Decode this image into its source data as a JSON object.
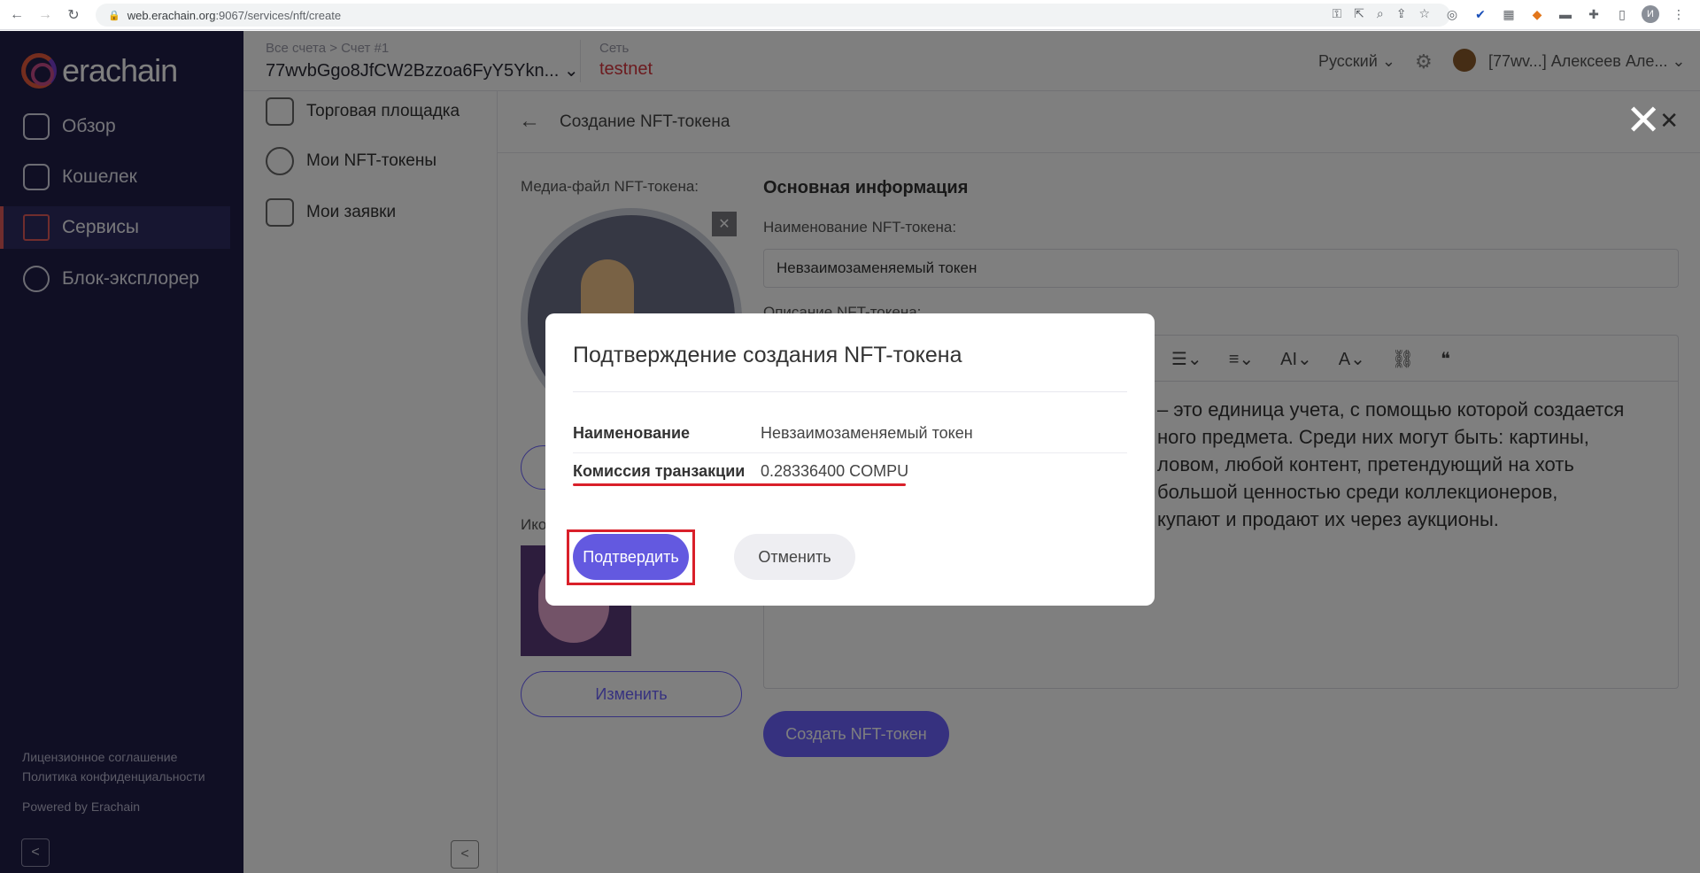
{
  "browser": {
    "url_host": "web.erachain.org",
    "url_path": ":9067/services/nft/create",
    "profile_initial": "И"
  },
  "sidebar": {
    "logo_text": "erachain",
    "items": [
      {
        "label": "Обзор",
        "icon": "overview-icon"
      },
      {
        "label": "Кошелек",
        "icon": "wallet-icon"
      },
      {
        "label": "Сервисы",
        "icon": "services-icon"
      },
      {
        "label": "Блок-эксплорер",
        "icon": "explorer-icon"
      }
    ],
    "active_item": "Сервисы",
    "footer": {
      "license": "Лицензионное соглашение",
      "privacy": "Политика конфиденциальности",
      "powered": "Powered by Erachain"
    }
  },
  "header": {
    "breadcrumb": "Все счета > Счет #1",
    "account_address": "77wvbGgo8JfCW2Bzzoa6FyY5Ykn...",
    "network_label": "Сеть",
    "network_value": "testnet",
    "language": "Русский",
    "user_name": "[77wv...] Алексеев Але..."
  },
  "submenu": {
    "items": [
      {
        "label": "Торговая площадка"
      },
      {
        "label": "Мои NFT-токены"
      },
      {
        "label": "Мои заявки"
      }
    ]
  },
  "main": {
    "page_title": "Создание NFT-токена",
    "media_label": "Медиа-файл NFT-токена:",
    "icon_label": "Ико",
    "change_button": "Изменить",
    "section_title": "Основная информация",
    "name_label": "Наименование NFT-токена:",
    "name_value": "Невзаимозаменяемый токен",
    "description_label": "Описание NFT-токена:",
    "description_lines": [
      "– это единица учета, с помощью которой создается",
      "ного предмета. Среди них могут быть: картины,",
      "ловом, любой контент, претендующий на хоть",
      "большой ценностью среди коллекционеров,",
      "купают и продают их через аукционы."
    ],
    "create_button": "Создать NFT-токен"
  },
  "modal": {
    "title": "Подтверждение создания NFT-токена",
    "rows": [
      {
        "label": "Наименование",
        "value": "Невзаимозаменяемый токен"
      },
      {
        "label": "Комиссия транзакции",
        "value": "0.28336400 COMPU"
      }
    ],
    "confirm_label": "Подтвердить",
    "cancel_label": "Отменить"
  }
}
